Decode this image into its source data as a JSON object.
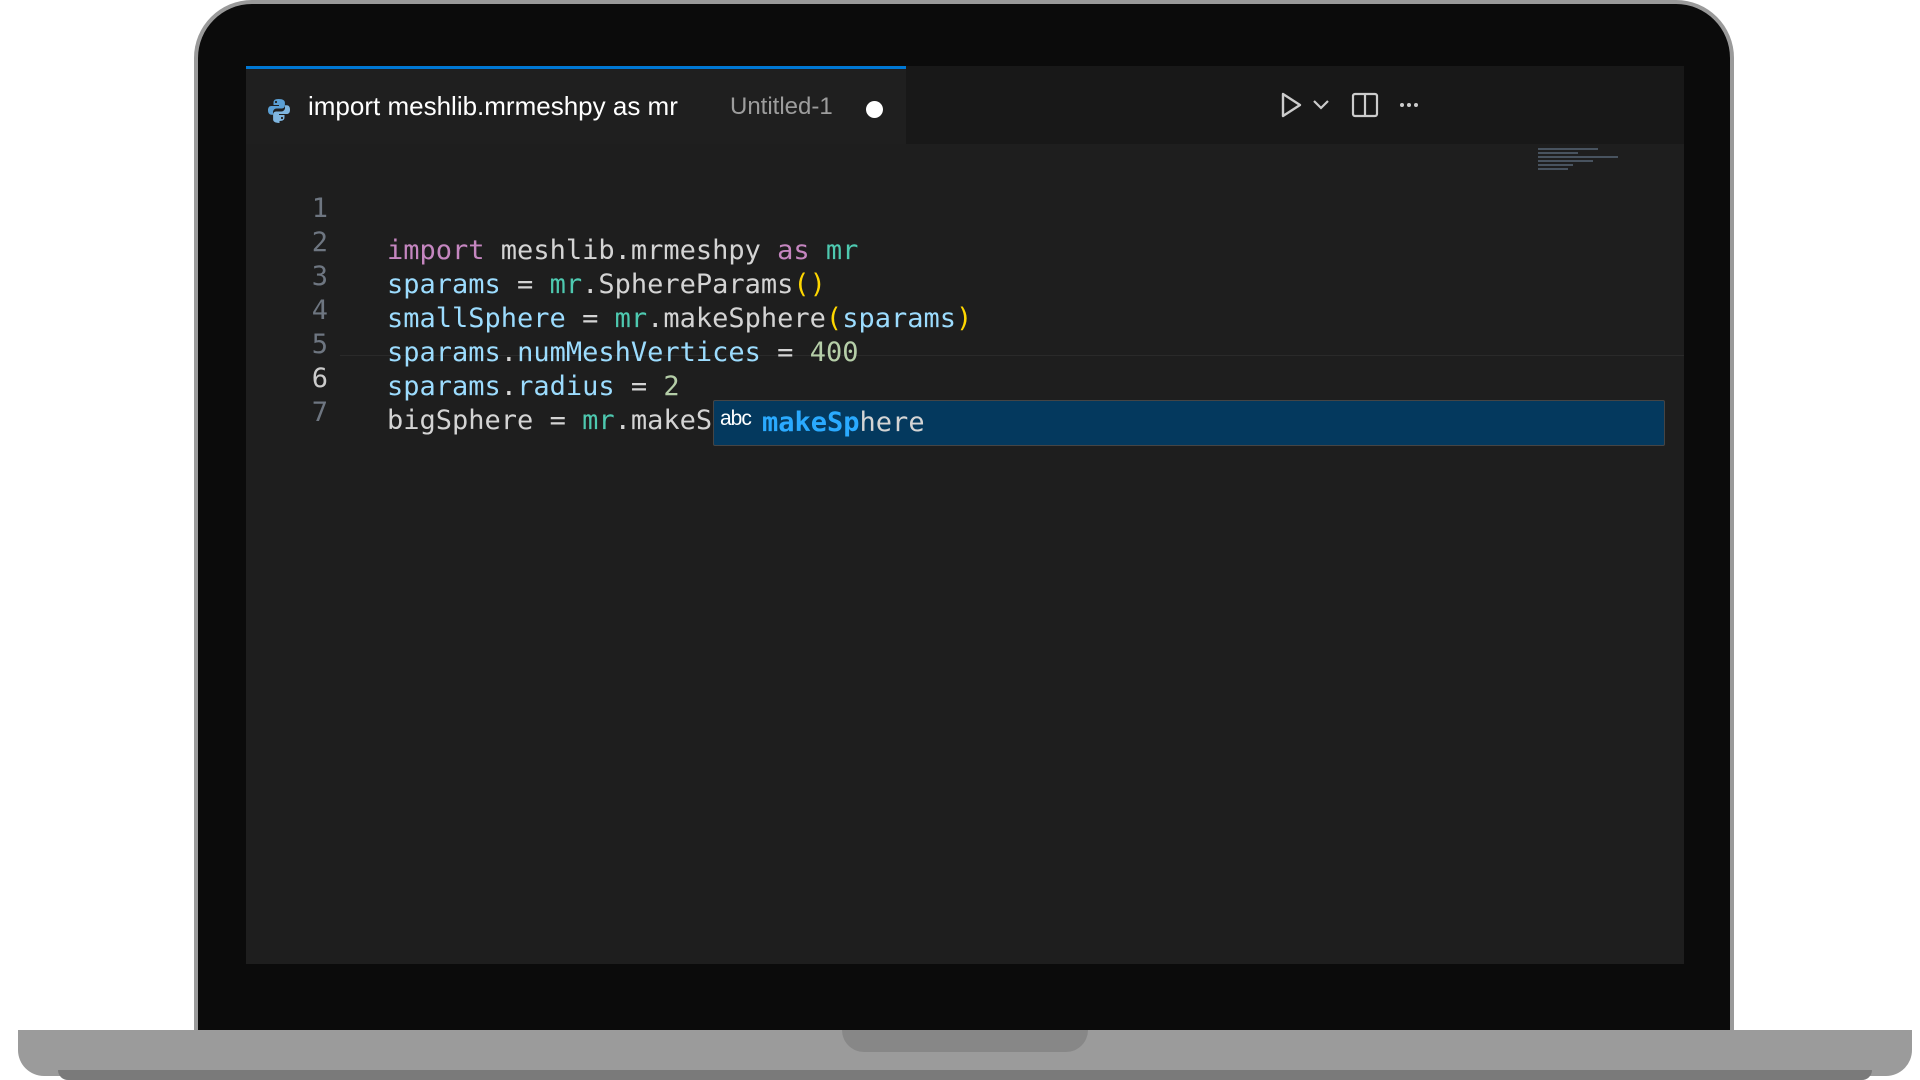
{
  "editor": {
    "tab": {
      "title": "import meshlib.mrmeshpy as mr",
      "description": "Untitled-1",
      "language_icon": "python-icon",
      "dirty": true
    },
    "toolbar": {
      "run_icon": "play-icon",
      "run_dropdown_icon": "chevron-down-icon",
      "split_icon": "split-editor-icon",
      "more_icon": "ellipsis-icon"
    },
    "active_line": 6,
    "lines": [
      {
        "number": "1",
        "text": "import meshlib.mrmeshpy as mr"
      },
      {
        "number": "2",
        "text": "sparams = mr.SphereParams()"
      },
      {
        "number": "3",
        "text": "smallSphere = mr.makeSphere(sparams)"
      },
      {
        "number": "4",
        "text": "sparams.numMeshVertices = 400"
      },
      {
        "number": "5",
        "text": "sparams.radius = 2"
      },
      {
        "number": "6",
        "text": "bigSphere = mr.makeSp"
      },
      {
        "number": "7",
        "text": ""
      }
    ],
    "code_tokens": {
      "l1": [
        "import",
        " meshlib.mrmeshpy ",
        "as",
        " mr"
      ],
      "l2": [
        "sparams",
        " = ",
        "mr",
        ".SphereParams",
        "()"
      ],
      "l3": [
        "smallSphere",
        " = ",
        "mr",
        ".makeSphere",
        "(",
        "sparams",
        ")"
      ],
      "l4": [
        "sparams",
        ".",
        "numMeshVertices",
        " = ",
        "400"
      ],
      "l5": [
        "sparams",
        ".",
        "radius",
        " = ",
        "2"
      ],
      "l6": [
        "bigSphere",
        " = ",
        "mr",
        ".makeSp"
      ]
    },
    "suggestion": {
      "kind": "abc",
      "match": "makeSp",
      "rest": "here",
      "full": "makeSphere"
    }
  }
}
